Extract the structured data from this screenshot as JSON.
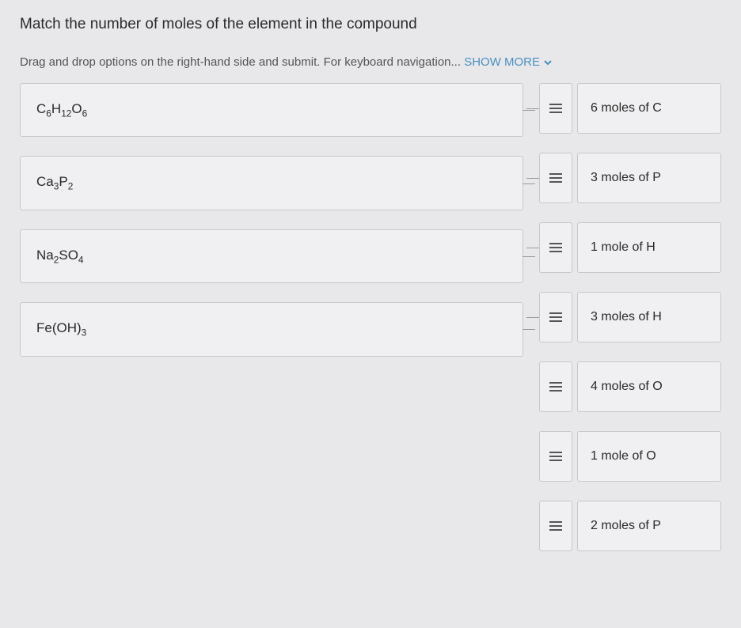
{
  "question": {
    "title": "Match the number of moles of the element in the compound",
    "instructions_prefix": "Drag and drop options on the right-hand side and submit. For keyboard navigation... ",
    "show_more_label": "SHOW MORE"
  },
  "prompts": [
    {
      "formula_html": "C<sub>6</sub>H<sub>12</sub>O<sub>6</sub>"
    },
    {
      "formula_html": "Ca<sub>3</sub>P<sub>2</sub>"
    },
    {
      "formula_html": "Na<sub>2</sub>SO<sub>4</sub>"
    },
    {
      "formula_html": "Fe(OH)<sub>3</sub>"
    }
  ],
  "answers": [
    {
      "label": "6 moles of C",
      "connected": true
    },
    {
      "label": "3 moles of P",
      "connected": true
    },
    {
      "label": "1 mole of H",
      "connected": true
    },
    {
      "label": "3 moles of H",
      "connected": true
    },
    {
      "label": "4 moles of O",
      "connected": false
    },
    {
      "label": "1 mole of O",
      "connected": false
    },
    {
      "label": "2 moles of P",
      "connected": false
    }
  ]
}
